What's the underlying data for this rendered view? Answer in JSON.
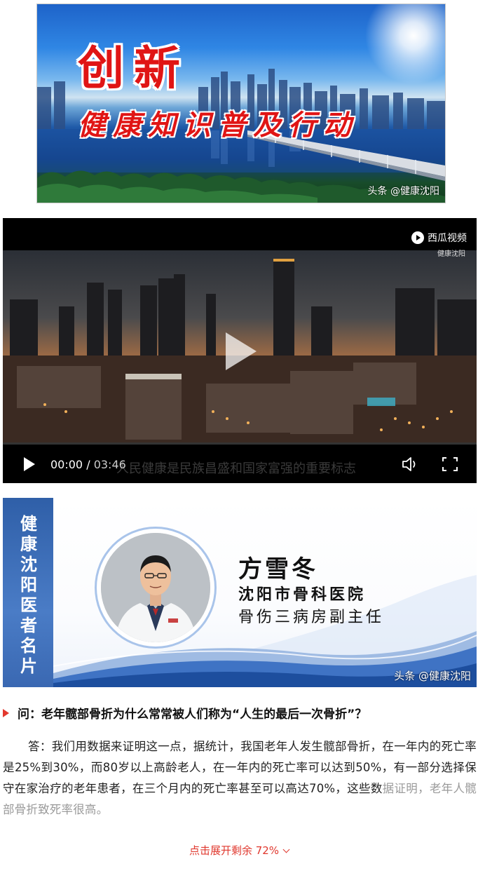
{
  "banner": {
    "title_big": "创新",
    "title_sub": "健康知识普及行动",
    "watermark": "头条 @健康沈阳"
  },
  "video": {
    "platform_label": "西瓜视频",
    "channel_label": "健康沈阳",
    "subtitle": "人民健康是民族昌盛和国家富强的重要标志",
    "current_time": "00:00",
    "separator": "/",
    "duration": "03:46",
    "progress": 0,
    "icons": [
      "play-icon",
      "volume-icon",
      "fullscreen-icon",
      "big-play-icon",
      "xigua-logo-icon"
    ]
  },
  "doctor_card": {
    "vertical_text": "健康沈阳医者名片",
    "name": "方雪冬",
    "hospital": "沈阳市骨科医院",
    "position": "骨伤三病房副主任",
    "watermark": "头条 @健康沈阳",
    "accent_color": "#3a68b2"
  },
  "article": {
    "question": "问：老年髋部骨折为什么常常被人们称为“人生的最后一次骨折”？",
    "answer_main": "答：我们用数据来证明这一点，据统计，我国老年人发生髋部骨折，在一年内的死亡率是25%到30%，而80岁以上高龄老人，在一年内的死亡率可以达到50%，有一部分选择保守在家治疗的老年患者，在三个月内的死亡率甚至可以高达70%，这些数",
    "answer_faded": "据证明，老年人髋部骨折致死率很高。",
    "expand_label": "点击展开剩余 72%",
    "accent_color": "#e0382e"
  }
}
